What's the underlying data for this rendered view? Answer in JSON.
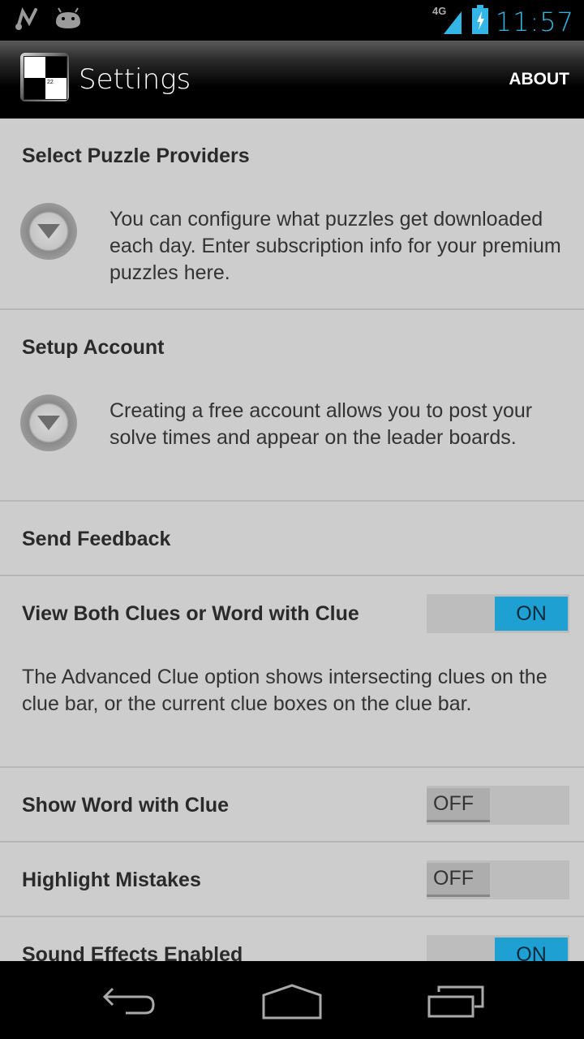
{
  "status_bar": {
    "left_icons": [
      "notification-app-icon",
      "android-debug-icon"
    ],
    "network": "4G",
    "time": "11:57"
  },
  "action_bar": {
    "title": "Settings",
    "app_icon_number": "22",
    "about_label": "ABOUT"
  },
  "preferences": [
    {
      "title": "Select Puzzle Providers",
      "summary": "You can configure what puzzles get downloaded each day.  Enter subscription info for your premium puzzles here.",
      "icon": "expand-circle-icon"
    },
    {
      "title": "Setup Account",
      "summary": "Creating a free account allows you to post your solve times and appear on the leader boards.",
      "icon": "expand-circle-icon"
    },
    {
      "title": "Send Feedback"
    },
    {
      "title": "View Both Clues or Word with Clue",
      "toggle": "ON",
      "summary": "The Advanced Clue option shows intersecting clues on the clue bar, or the current clue boxes on the clue bar."
    },
    {
      "title": "Show Word with Clue",
      "toggle": "OFF"
    },
    {
      "title": "Highlight Mistakes",
      "toggle": "OFF"
    },
    {
      "title": "Sound Effects Enabled",
      "toggle": "ON"
    }
  ],
  "colors": {
    "accent": "#33b5e5",
    "toggle_on": "#1ea0d3",
    "background": "#cdcdcd"
  },
  "nav_bar": {
    "buttons": [
      "back",
      "home",
      "recent-apps"
    ]
  }
}
